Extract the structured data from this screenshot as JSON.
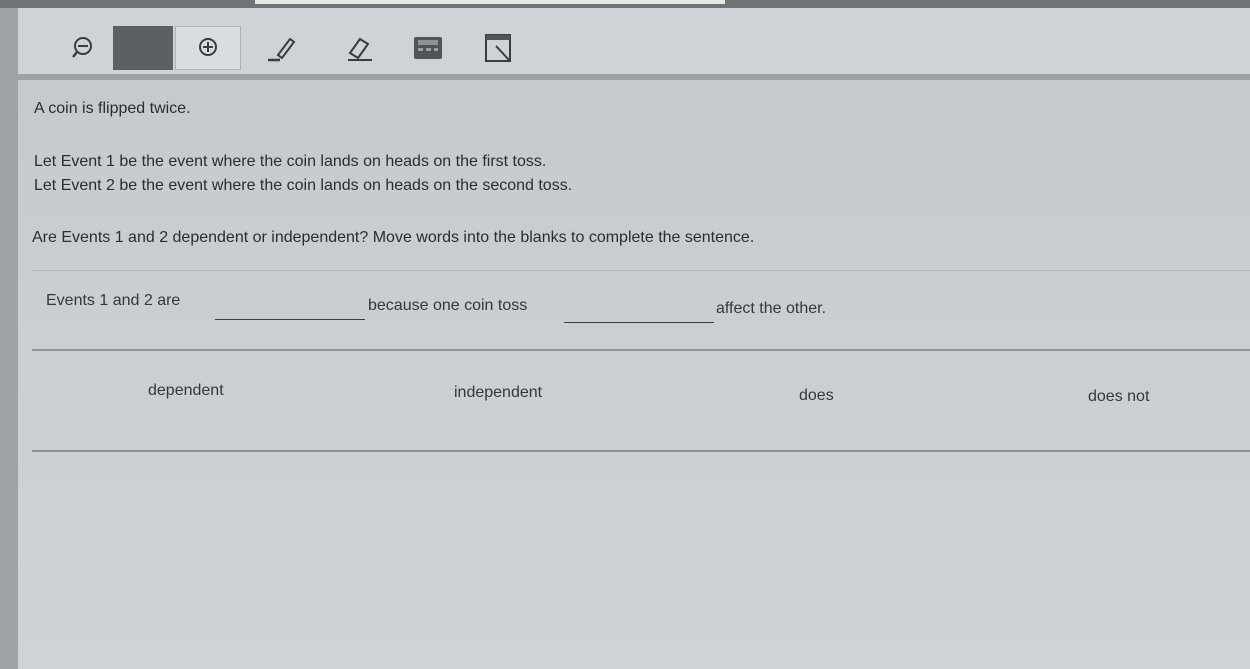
{
  "toolbar": {
    "tools": [
      {
        "icon": "zoom-out-icon"
      },
      {
        "icon": "dark-tool"
      },
      {
        "icon": "zoom-in-icon"
      },
      {
        "icon": "pen-icon"
      },
      {
        "icon": "eraser-icon"
      },
      {
        "icon": "calculator-icon"
      },
      {
        "icon": "notepad-icon"
      }
    ]
  },
  "question": {
    "line1": "A coin is flipped twice.",
    "line2": "Let Event 1 be the event where the coin lands on heads on the first toss.",
    "line3": "Let Event 2 be the event where the coin lands on heads on the second toss.",
    "prompt": "Are Events 1 and 2 dependent or independent? Move words into the blanks to complete the sentence."
  },
  "sentence": {
    "part1": "Events 1 and 2 are",
    "part2": "because one coin toss",
    "part3": "affect the other."
  },
  "word_bank": [
    "dependent",
    "independent",
    "does",
    "does not"
  ],
  "colors": {
    "background": "#c9cfd3",
    "toolbar": "#cdd3d6",
    "text": "#2e3034"
  }
}
